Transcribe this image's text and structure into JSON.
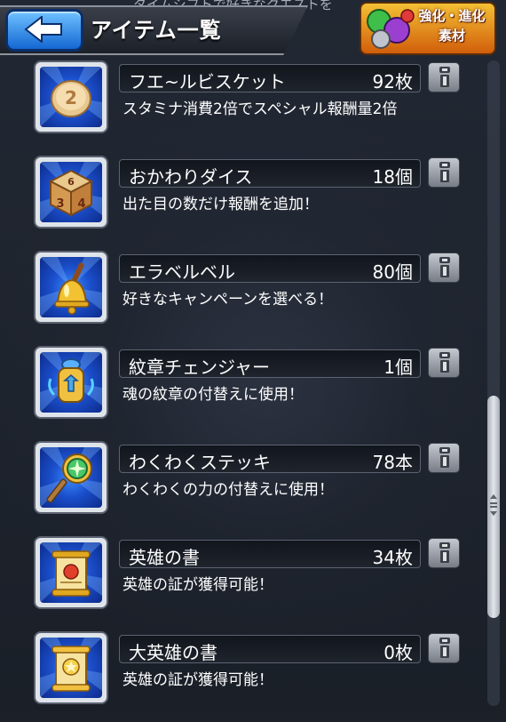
{
  "header": {
    "title": "アイテム一覧",
    "ticker": "タイムシフトで好きなクエストを",
    "back_icon": "left-arrow-icon",
    "evo_button": {
      "line1": "強化・進化",
      "line2": "素材"
    }
  },
  "items": [
    {
      "name": "フエ~ルビスケット",
      "count": "92枚",
      "description": "スタミナ消費2倍でスペシャル報酬量2倍",
      "icon": "biscuit-icon"
    },
    {
      "name": "おかわりダイス",
      "count": "18個",
      "description": "出た目の数だけ報酬を追加！",
      "icon": "dice-icon"
    },
    {
      "name": "エラベルベル",
      "count": "80個",
      "description": "好きなキャンペーンを選べる！",
      "icon": "bell-icon"
    },
    {
      "name": "紋章チェンジャー",
      "count": "1個",
      "description": "魂の紋章の付替えに使用！",
      "icon": "crest-changer-icon"
    },
    {
      "name": "わくわくステッキ",
      "count": "78本",
      "description": "わくわくの力の付替えに使用！",
      "icon": "wand-icon"
    },
    {
      "name": "英雄の書",
      "count": "34枚",
      "description": "英雄の証が獲得可能！",
      "icon": "scroll-icon"
    },
    {
      "name": "大英雄の書",
      "count": "0枚",
      "description": "英雄の証が獲得可能！",
      "icon": "grand-scroll-icon"
    }
  ],
  "colors": {
    "accent_blue": "#1b4fcc",
    "evo_orange": "#d15e0b"
  }
}
